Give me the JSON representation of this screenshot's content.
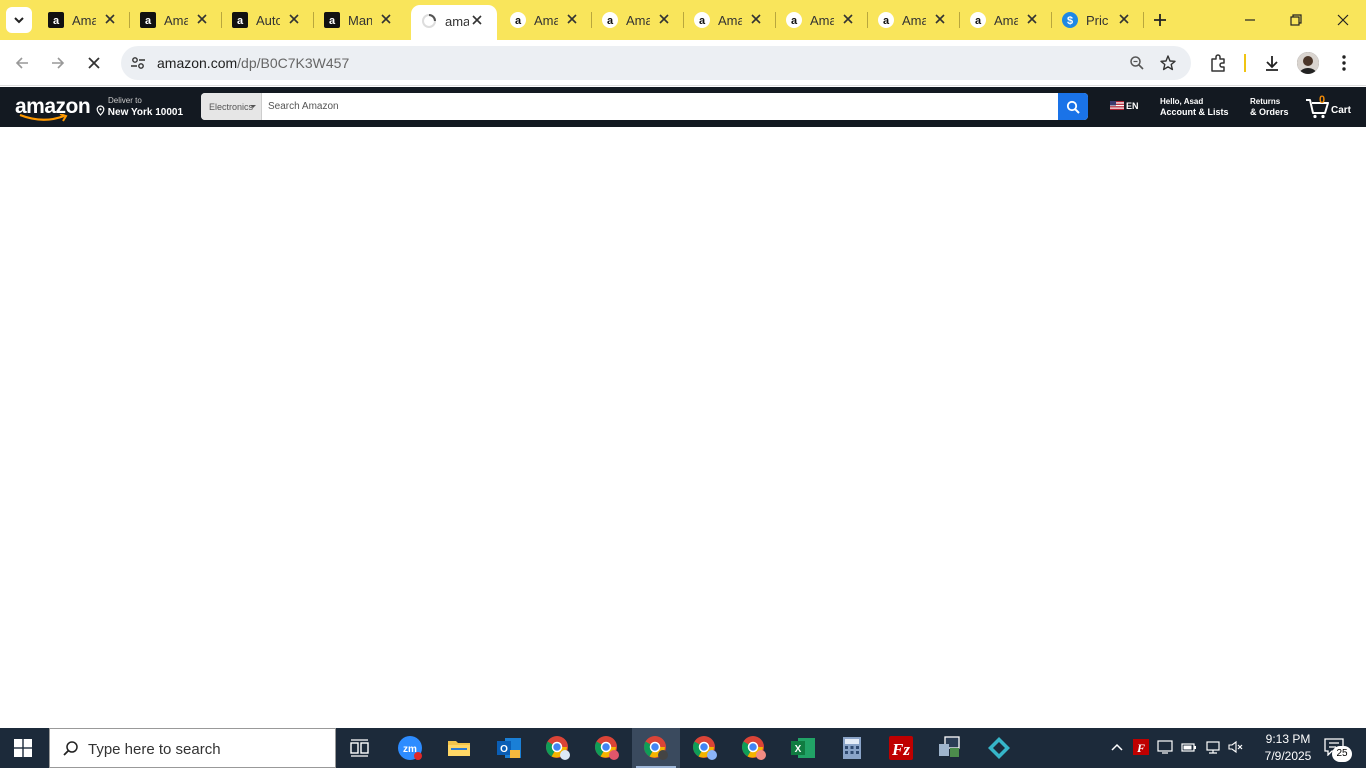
{
  "tabs": [
    {
      "title": "Ama",
      "favicon": "amazon-square-icon"
    },
    {
      "title": "Ama",
      "favicon": "amazon-square-icon"
    },
    {
      "title": "Auto",
      "favicon": "amazon-square-icon"
    },
    {
      "title": "Man",
      "favicon": "amazon-square-icon"
    },
    {
      "title": "ama",
      "favicon": "loading-spinner-icon",
      "active": true
    },
    {
      "title": "Ama",
      "favicon": "amazon-circle-icon"
    },
    {
      "title": "Ama",
      "favicon": "amazon-circle-icon"
    },
    {
      "title": "Ama",
      "favicon": "amazon-circle-icon"
    },
    {
      "title": "Ama",
      "favicon": "amazon-circle-icon"
    },
    {
      "title": "Ama",
      "favicon": "amazon-circle-icon"
    },
    {
      "title": "Ama",
      "favicon": "amazon-circle-icon"
    },
    {
      "title": "Pric",
      "favicon": "dollar-icon"
    }
  ],
  "omnibox": {
    "domain": "amazon.com",
    "path": "/dp/B0C7K3W457"
  },
  "amazon": {
    "logo": "amazon",
    "deliver_line1": "Deliver to",
    "deliver_line2": "New York 10001",
    "search_category": "Electronics",
    "search_placeholder": "Search Amazon",
    "lang": "EN",
    "account_line1": "Hello, Asad",
    "account_line2": "Account & Lists",
    "returns_line1": "Returns",
    "returns_line2": "& Orders",
    "cart_count": "0",
    "cart_label": "Cart"
  },
  "taskbar": {
    "search_placeholder": "Type here to search",
    "apps": [
      "task-view",
      "zoom",
      "file-explorer",
      "outlook",
      "chrome",
      "chrome",
      "chrome",
      "chrome",
      "chrome",
      "excel",
      "calculator",
      "filezilla",
      "remote-desktop",
      "app-diamond"
    ],
    "time": "9:13 PM",
    "date": "7/9/2025",
    "notification_count": "25"
  },
  "colors": {
    "tabstrip": "#f9e55b",
    "amazon_nav": "#131921",
    "amazon_search_btn": "#1a73e8",
    "taskbar": "#1c2a3a"
  }
}
